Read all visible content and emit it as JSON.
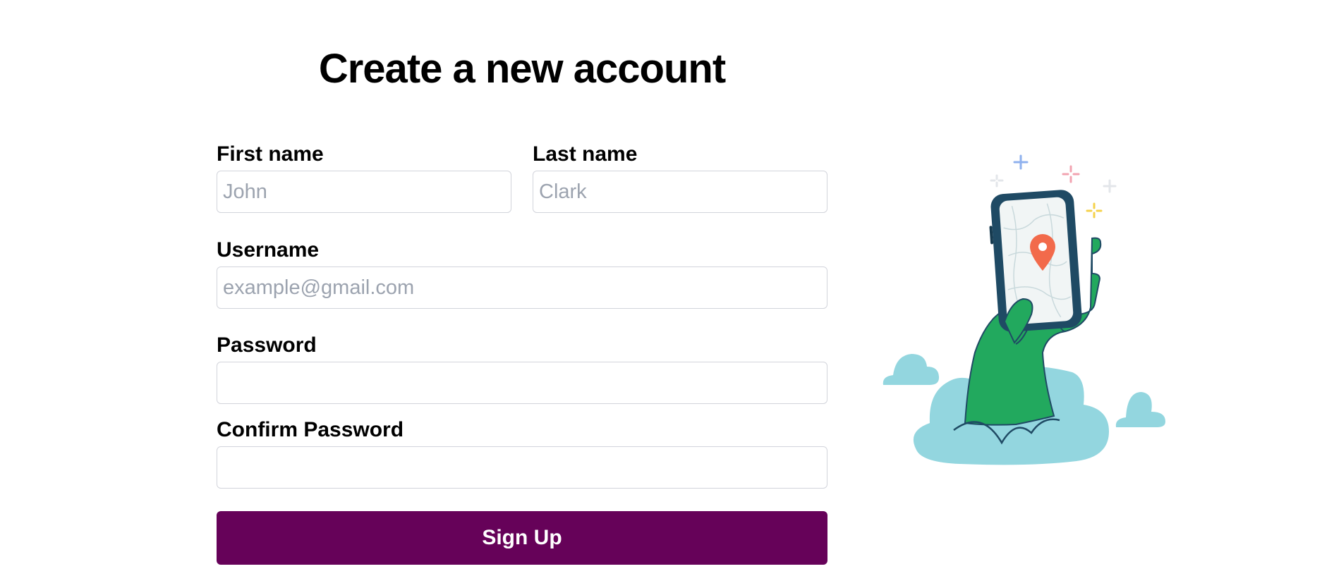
{
  "page": {
    "title": "Create a new account"
  },
  "form": {
    "first_name": {
      "label": "First name",
      "placeholder": "John",
      "value": ""
    },
    "last_name": {
      "label": "Last name",
      "placeholder": "Clark",
      "value": ""
    },
    "username": {
      "label": "Username",
      "placeholder": "example@gmail.com",
      "value": ""
    },
    "password": {
      "label": "Password",
      "placeholder": "",
      "value": ""
    },
    "confirm_password": {
      "label": "Confirm Password",
      "placeholder": "",
      "value": ""
    },
    "submit_label": "Sign Up"
  },
  "illustration": {
    "icon": "hand-holding-phone-map-icon"
  },
  "colors": {
    "button_bg": "#660259",
    "button_text": "#ffffff",
    "input_border": "#d2d4db",
    "placeholder": "#9ca3af",
    "hand": "#22a95e",
    "cloud": "#93d6df",
    "phone_frame": "#1f4a64",
    "pin": "#f26a4b"
  }
}
